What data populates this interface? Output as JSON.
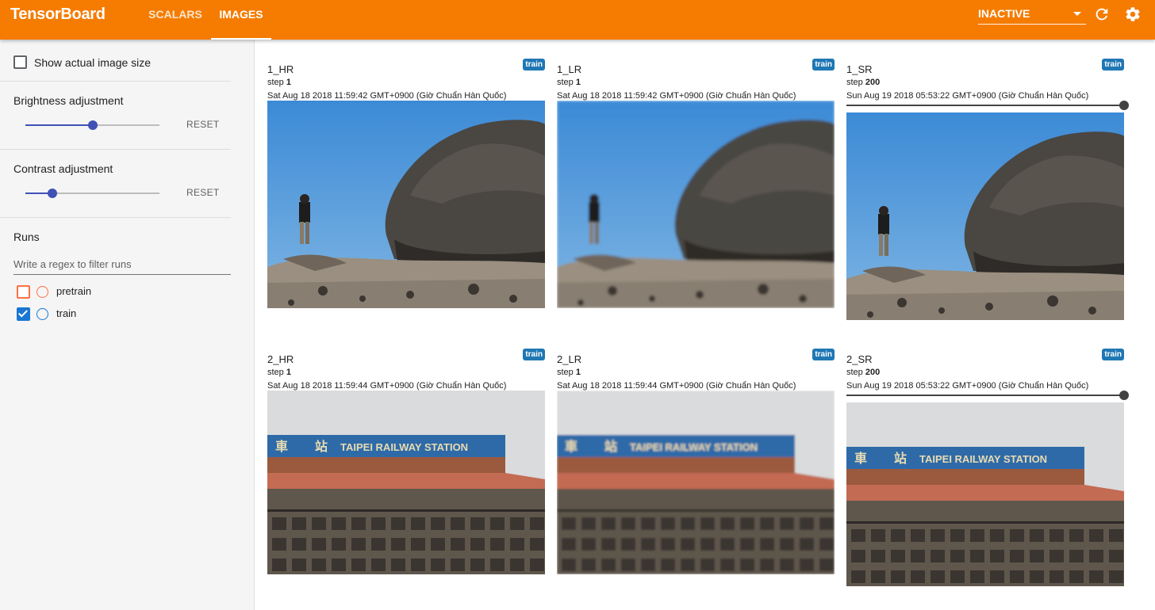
{
  "header": {
    "brand": "TensorBoard",
    "tabs": [
      {
        "label": "SCALARS",
        "active": false
      },
      {
        "label": "IMAGES",
        "active": true
      }
    ],
    "run_select": "INACTIVE",
    "icons": [
      "refresh-icon",
      "settings-icon"
    ],
    "accent": "#f57c00"
  },
  "sidebar": {
    "show_actual_size": {
      "label": "Show actual image size",
      "checked": false
    },
    "brightness": {
      "label": "Brightness adjustment",
      "reset": "RESET",
      "level": 0.5
    },
    "contrast": {
      "label": "Contrast adjustment",
      "reset": "RESET",
      "level": 0.2
    },
    "runs": {
      "title": "Runs",
      "filter_placeholder": "Write a regex to filter runs",
      "items": [
        {
          "label": "pretrain",
          "checked": false,
          "color": "#ff7043"
        },
        {
          "label": "train",
          "checked": true,
          "color": "#1976d2"
        }
      ]
    }
  },
  "cards": [
    {
      "title": "1_HR",
      "badge": "train",
      "step_label": "step",
      "step": "1",
      "time": "Sat Aug 18 2018 11:59:42 GMT+0900 (Giờ Chuẩn Hàn Quốc)",
      "slider": false,
      "scene": "rock"
    },
    {
      "title": "1_LR",
      "badge": "train",
      "step_label": "step",
      "step": "1",
      "time": "Sat Aug 18 2018 11:59:42 GMT+0900 (Giờ Chuẩn Hàn Quốc)",
      "slider": false,
      "scene": "rock"
    },
    {
      "title": "1_SR",
      "badge": "train",
      "step_label": "step",
      "step": "200",
      "time": "Sun Aug 19 2018 05:53:22 GMT+0900 (Giờ Chuẩn Hàn Quốc)",
      "slider": true,
      "scene": "rock"
    },
    {
      "title": "2_HR",
      "badge": "train",
      "step_label": "step",
      "step": "1",
      "time": "Sat Aug 18 2018 11:59:44 GMT+0900 (Giờ Chuẩn Hàn Quốc)",
      "slider": false,
      "scene": "station",
      "sign": "TAIPEI RAILWAY STATION"
    },
    {
      "title": "2_LR",
      "badge": "train",
      "step_label": "step",
      "step": "1",
      "time": "Sat Aug 18 2018 11:59:44 GMT+0900 (Giờ Chuẩn Hàn Quốc)",
      "slider": false,
      "scene": "station",
      "sign": "TAIPEI RAILWAY STATION"
    },
    {
      "title": "2_SR",
      "badge": "train",
      "step_label": "step",
      "step": "200",
      "time": "Sun Aug 19 2018 05:53:22 GMT+0900 (Giờ Chuẩn Hàn Quốc)",
      "slider": true,
      "scene": "station",
      "sign": "TAIPEI RAILWAY STATION"
    }
  ]
}
